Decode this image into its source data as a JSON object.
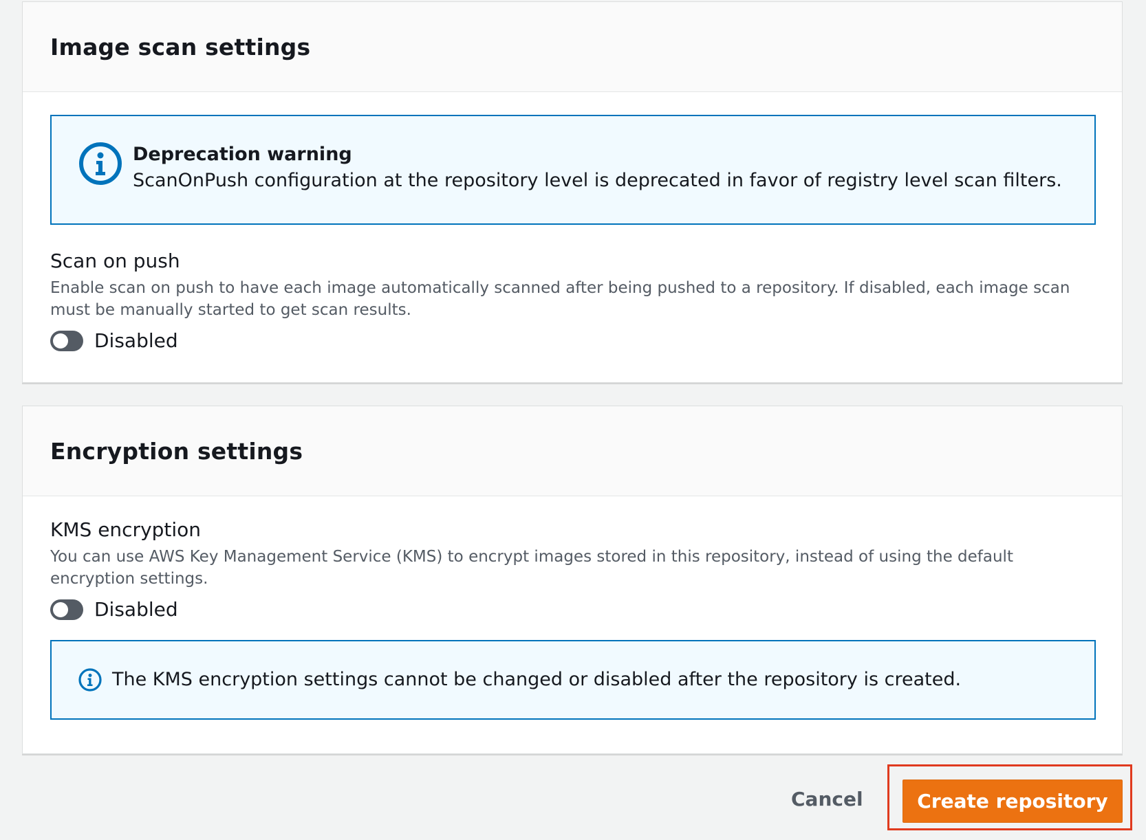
{
  "scan_panel": {
    "title": "Image scan settings",
    "alert": {
      "icon": "info-icon",
      "title": "Deprecation warning",
      "message": "ScanOnPush configuration at the repository level is deprecated in favor of registry level scan filters."
    },
    "field": {
      "label": "Scan on push",
      "description": "Enable scan on push to have each image automatically scanned after being pushed to a repository. If disabled, each image scan must be manually started to get scan results.",
      "toggle_state": "Disabled",
      "enabled": false
    }
  },
  "encryption_panel": {
    "title": "Encryption settings",
    "field": {
      "label": "KMS encryption",
      "description": "You can use AWS Key Management Service (KMS) to encrypt images stored in this repository, instead of using the default encryption settings.",
      "toggle_state": "Disabled",
      "enabled": false
    },
    "alert": {
      "icon": "info-icon",
      "message": "The KMS encryption settings cannot be changed or disabled after the repository is created."
    }
  },
  "footer": {
    "cancel_label": "Cancel",
    "create_label": "Create repository"
  },
  "colors": {
    "primary_button": "#ec7211",
    "info_border": "#0073bb",
    "info_background": "#f1faff",
    "highlight": "#e03a1e"
  }
}
